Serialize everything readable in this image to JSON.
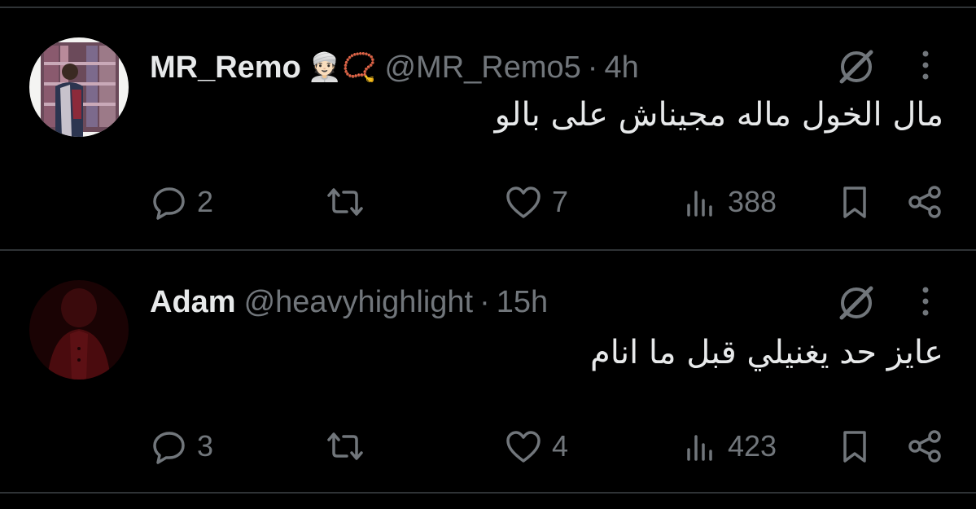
{
  "tweets": [
    {
      "name": "MR_Remo",
      "name_emojis": "👳🏻📿",
      "handle": "@MR_Remo5",
      "separator": "·",
      "time": "4h",
      "text": "مال الخول ماله مجيناش على بالو",
      "replies": "2",
      "likes": "7",
      "views": "388"
    },
    {
      "name": "Adam",
      "handle": "@heavyhighlight",
      "separator": "·",
      "time": "15h",
      "text": "عايز حد يغنيلي قبل ما انام",
      "replies": "3",
      "likes": "4",
      "views": "423"
    }
  ],
  "icons": {
    "reply": "reply-icon",
    "retweet": "retweet-icon",
    "like": "like-icon",
    "views": "views-icon",
    "bookmark": "bookmark-icon",
    "share": "share-icon",
    "grok": "grok-icon",
    "more": "more-icon"
  },
  "colors": {
    "background": "#000000",
    "text": "#e7e9ea",
    "muted": "#71767b",
    "divider": "#2f3336"
  }
}
